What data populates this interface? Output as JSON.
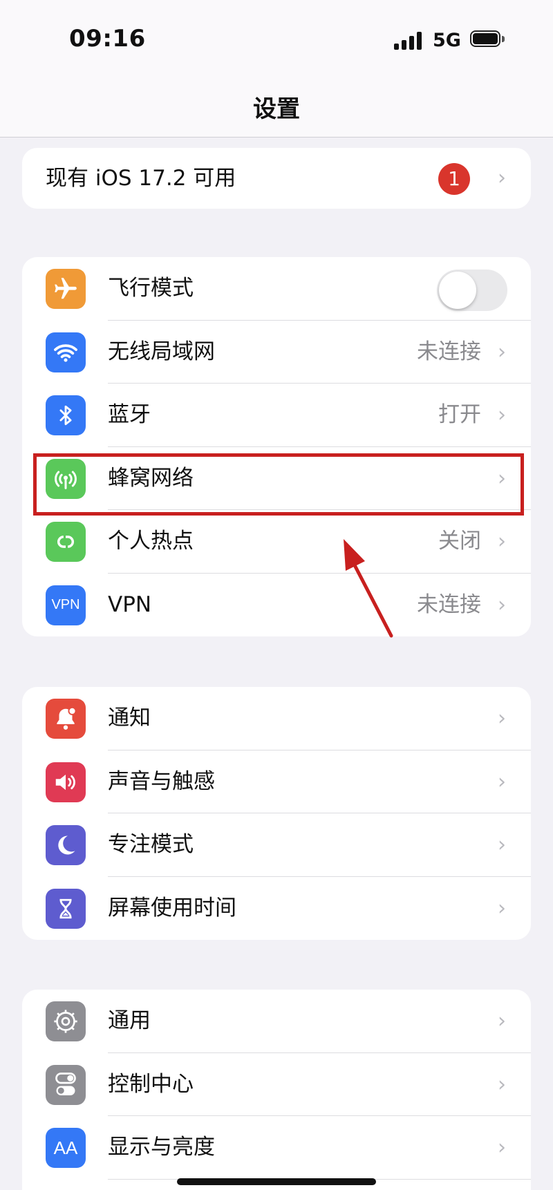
{
  "status": {
    "time": "09:16",
    "network": "5G"
  },
  "nav": {
    "title": "设置"
  },
  "update": {
    "label": "现有 iOS 17.2 可用",
    "badge": "1"
  },
  "connectivity": {
    "airplane": {
      "label": "飞行模式",
      "toggle_on": false,
      "color": "#f09a37"
    },
    "wifi": {
      "label": "无线局域网",
      "value": "未连接",
      "color": "#3478f6"
    },
    "bluetooth": {
      "label": "蓝牙",
      "value": "打开",
      "color": "#3478f6"
    },
    "cellular": {
      "label": "蜂窝网络",
      "color": "#5ac85a"
    },
    "hotspot": {
      "label": "个人热点",
      "value": "关闭",
      "color": "#5ac85a"
    },
    "vpn": {
      "label": "VPN",
      "value": "未连接",
      "icon_text": "VPN",
      "color": "#3478f6"
    }
  },
  "alerts": {
    "notifications": {
      "label": "通知",
      "color": "#e54b3c"
    },
    "sounds": {
      "label": "声音与触感",
      "color": "#e03a54"
    },
    "focus": {
      "label": "专注模式",
      "color": "#5e5ccf"
    },
    "screentime": {
      "label": "屏幕使用时间",
      "color": "#5e5ccf"
    }
  },
  "system": {
    "general": {
      "label": "通用",
      "color": "#8e8e93"
    },
    "control_center": {
      "label": "控制中心",
      "color": "#8e8e93"
    },
    "display": {
      "label": "显示与亮度",
      "icon_text": "AA",
      "color": "#3478f6"
    }
  },
  "annotation": {
    "highlight_color": "#c8201f",
    "target": "蜂窝网络"
  }
}
